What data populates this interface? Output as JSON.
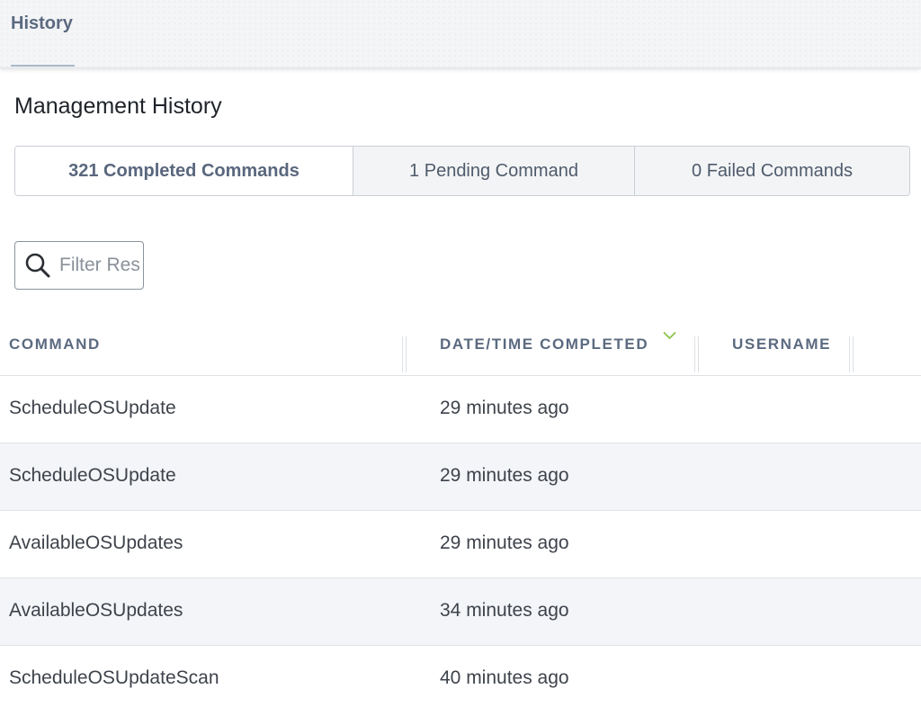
{
  "tabs": [
    {
      "label": "History",
      "active": true
    }
  ],
  "page": {
    "title": "Management History"
  },
  "segments": [
    {
      "label": "321 Completed Commands",
      "active": true
    },
    {
      "label": "1 Pending Command",
      "active": false
    },
    {
      "label": "0 Failed Commands",
      "active": false
    }
  ],
  "filter": {
    "placeholder": "Filter Results",
    "value": "",
    "icon": "search-icon"
  },
  "table": {
    "columns": [
      "COMMAND",
      "DATE/TIME COMPLETED",
      "USERNAME"
    ],
    "sort": {
      "column": "DATE/TIME COMPLETED",
      "direction": "descending",
      "icon": "chevron-down-icon"
    },
    "rows": [
      {
        "command": "ScheduleOSUpdate",
        "completed": "29 minutes ago",
        "username": ""
      },
      {
        "command": "ScheduleOSUpdate",
        "completed": "29 minutes ago",
        "username": ""
      },
      {
        "command": "AvailableOSUpdates",
        "completed": "29 minutes ago",
        "username": ""
      },
      {
        "command": "AvailableOSUpdates",
        "completed": "34 minutes ago",
        "username": ""
      },
      {
        "command": "ScheduleOSUpdateScan",
        "completed": "40 minutes ago",
        "username": ""
      }
    ]
  },
  "colors": {
    "accent": "#5b6a80",
    "sort_indicator": "#8bc34a",
    "row_alt": "#f3f5f8"
  }
}
